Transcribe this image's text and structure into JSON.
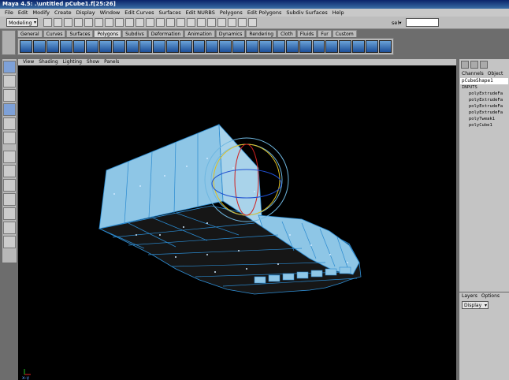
{
  "window": {
    "title": "Maya 4.5: .\\untitled    pCube1.f[25:26]"
  },
  "menubar": [
    "File",
    "Edit",
    "Modify",
    "Create",
    "Display",
    "Window",
    "Edit Curves",
    "Surfaces",
    "Edit NURBS",
    "Polygons",
    "Edit Polygons",
    "Subdiv Surfaces",
    "Help"
  ],
  "statusline": {
    "mode": "Modeling",
    "sel_label": "sel▾",
    "sel_value": ""
  },
  "shelf_tabs": [
    "General",
    "Curves",
    "Surfaces",
    "Polygons",
    "Subdivs",
    "Deformation",
    "Animation",
    "Dynamics",
    "Rendering",
    "Cloth",
    "Fluids",
    "Fur",
    "Custom"
  ],
  "active_shelf_tab": "Polygons",
  "panel_menu": [
    "View",
    "Shading",
    "Lighting",
    "Show",
    "Panels"
  ],
  "channel_box": {
    "menu": [
      "Channels",
      "Object"
    ],
    "node": "pCubeShape1",
    "inputs_label": "INPUTS",
    "inputs": [
      "polyExtrudeFa",
      "polyExtrudeFa",
      "polyExtrudeFa",
      "polyExtrudeFa",
      "polyTweak1",
      "polyCube1"
    ]
  },
  "layer_box": {
    "menu": [
      "Layers",
      "Options"
    ],
    "display": "Display"
  },
  "viewport": {
    "axis_label": "x-y",
    "model_fill": "#8ec6e6",
    "edge_color": "#2a8ad0",
    "bottom_fill": "#1a1a1a"
  }
}
